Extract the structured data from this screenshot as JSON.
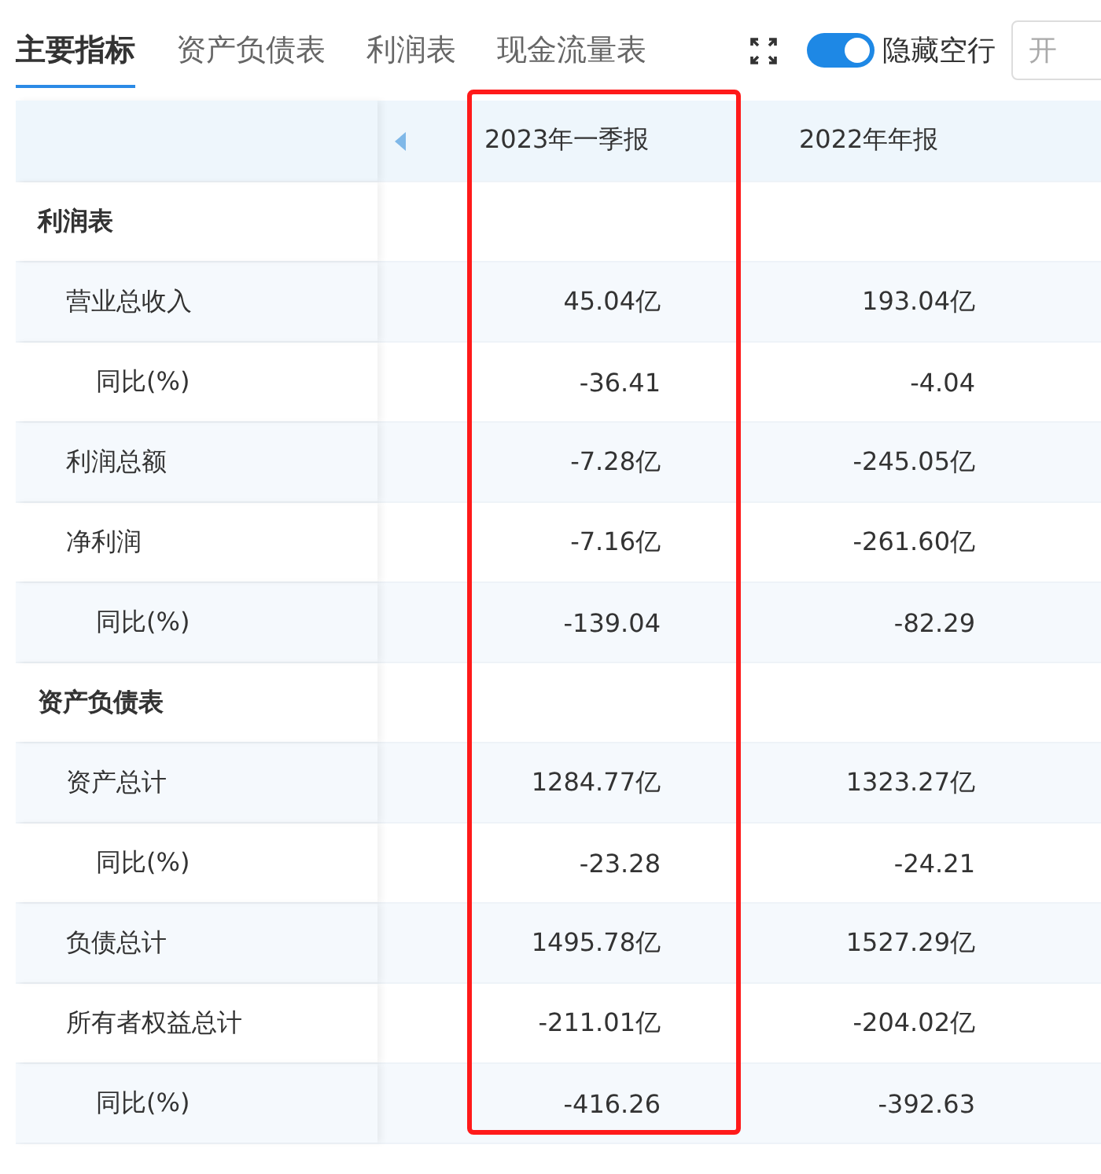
{
  "tabs": [
    {
      "label": "主要指标",
      "selected": true
    },
    {
      "label": "资产负债表",
      "selected": false
    },
    {
      "label": "利润表",
      "selected": false
    },
    {
      "label": "现金流量表",
      "selected": false
    }
  ],
  "toggle": {
    "label": "隐藏空行",
    "on": true
  },
  "date_field": {
    "placeholder": "开"
  },
  "table": {
    "columns": [
      "2023年一季报",
      "2022年年报"
    ],
    "sections": [
      {
        "name": "利润表",
        "rows": [
          {
            "name": "营业总收入",
            "values": [
              "45.04亿",
              "193.04亿"
            ],
            "children": [
              {
                "name": "同比(%)",
                "values": [
                  "-36.41",
                  "-4.04"
                ]
              }
            ]
          },
          {
            "name": "利润总额",
            "values": [
              "-7.28亿",
              "-245.05亿"
            ]
          },
          {
            "name": "净利润",
            "values": [
              "-7.16亿",
              "-261.60亿"
            ],
            "children": [
              {
                "name": "同比(%)",
                "values": [
                  "-139.04",
                  "-82.29"
                ]
              }
            ]
          }
        ]
      },
      {
        "name": "资产负债表",
        "rows": [
          {
            "name": "资产总计",
            "values": [
              "1284.77亿",
              "1323.27亿"
            ],
            "children": [
              {
                "name": "同比(%)",
                "values": [
                  "-23.28",
                  "-24.21"
                ]
              }
            ]
          },
          {
            "name": "负债总计",
            "values": [
              "1495.78亿",
              "1527.29亿"
            ]
          },
          {
            "name": "所有者权益总计",
            "values": [
              "-211.01亿",
              "-204.02亿"
            ],
            "children": [
              {
                "name": "同比(%)",
                "values": [
                  "-416.26",
                  "-392.63"
                ]
              }
            ]
          }
        ]
      }
    ]
  }
}
